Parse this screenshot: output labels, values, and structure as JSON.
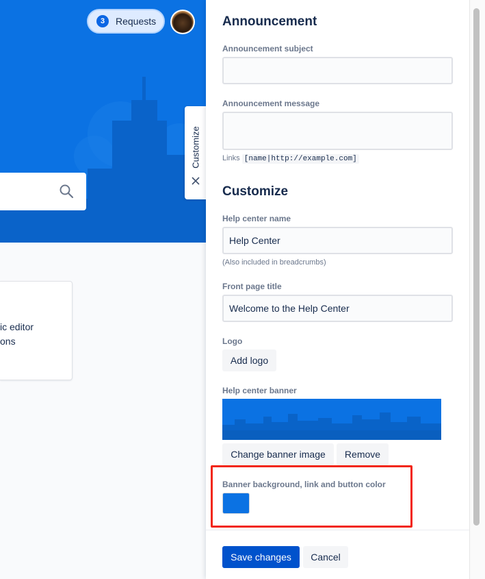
{
  "header": {
    "requests_count": "3",
    "requests_label": "Requests"
  },
  "portal_card": {
    "line1": "ic editor",
    "line2": "ons"
  },
  "customize_tab": {
    "label": "Customize"
  },
  "announcement": {
    "heading": "Announcement",
    "subject_label": "Announcement subject",
    "subject_value": "",
    "message_label": "Announcement message",
    "message_value": "",
    "links_hint_prefix": "Links",
    "links_hint_code": "[name|http://example.com]"
  },
  "customize": {
    "heading": "Customize",
    "help_center_name_label": "Help center name",
    "help_center_name_value": "Help Center",
    "help_center_name_hint": "(Also included in breadcrumbs)",
    "front_page_title_label": "Front page title",
    "front_page_title_value": "Welcome to the Help Center",
    "logo_label": "Logo",
    "add_logo_button": "Add logo",
    "banner_label": "Help center banner",
    "change_banner_button": "Change banner image",
    "remove_button": "Remove",
    "color_label": "Banner background, link and button color",
    "banner_color": "#0b72e3"
  },
  "footer": {
    "save_button": "Save changes",
    "cancel_button": "Cancel"
  },
  "colors": {
    "brand_blue": "#0b72e3",
    "primary_button": "#0052cc",
    "highlight_red": "#f22613"
  }
}
